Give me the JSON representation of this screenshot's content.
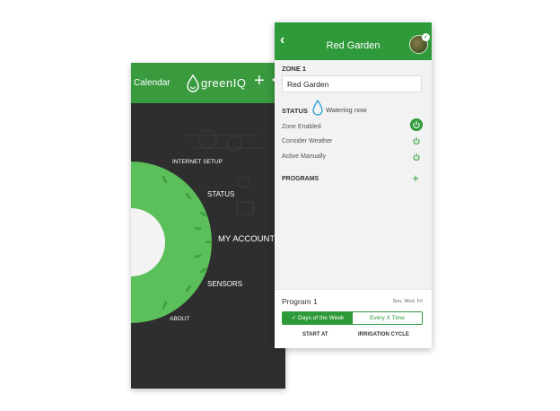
{
  "left_app": {
    "header": {
      "calendar_label": "Calendar",
      "logo_text": "greenIQ",
      "plus_label": "+",
      "more_label": "••"
    },
    "menu": {
      "internet_setup": "INTERNET SETUP",
      "status": "STATUS",
      "my_account": "MY ACCOUNT",
      "sensors": "SENSORS",
      "about": "ABOUT"
    },
    "colors": {
      "header": "#3a9a3e",
      "wheel": "#5bbf5a",
      "background": "#2e2e2e"
    }
  },
  "right_app": {
    "header": {
      "back_label": "‹",
      "title": "Red Garden",
      "check_label": "✓"
    },
    "zone": {
      "label": "ZONE 1",
      "name_value": "Red Garden"
    },
    "status": {
      "label": "STATUS",
      "text": "Watering now"
    },
    "toggles": [
      {
        "label": "Zone Enabled",
        "state": "on"
      },
      {
        "label": "Consider Weather",
        "state": "off"
      },
      {
        "label": "Active Manually",
        "state": "off"
      }
    ],
    "programs": {
      "label": "PROGRAMS",
      "add_label": "+"
    },
    "program": {
      "name": "Program 1",
      "days": "Sun, Wed, Fri",
      "tab_days_of_week": "✓ Days of the Week",
      "tab_every_x_time": "Every X Time",
      "start_at": "START AT",
      "irrigation_cycle": "IRRIGATION CYCLE"
    },
    "colors": {
      "header": "#2f9a3a",
      "accent": "#2f9a3a"
    }
  }
}
